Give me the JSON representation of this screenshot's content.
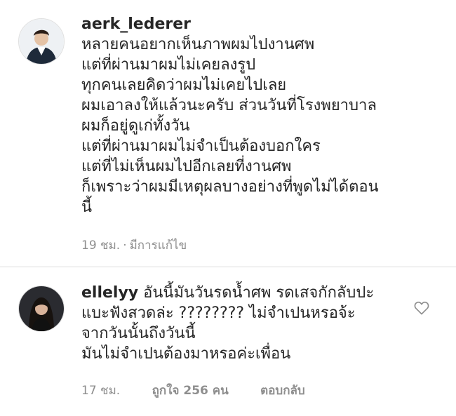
{
  "comments": [
    {
      "username": "aerk_lederer",
      "lines": [
        "หลายคนอยากเห็นภาพผมไปงานศพ",
        "แต่ที่ผ่านมาผมไม่เคยลงรูป",
        "ทุกคนเลยคิดว่าผมไม่เคยไปเลย",
        "ผมเอาลงให้แล้วนะครับ ส่วนวันที่โรงพยาบาล",
        "ผมก็อยู่ดูเก่ทั้งวัน",
        "แต่ที่ผ่านมาผมไม่จำเป็นต้องบอกใคร",
        "แต่ที่ไม่เห็นผมไปอีกเลยที่งานศพ",
        "ก็เพราะว่าผมมีเหตุผลบางอย่างที่พูดไม่ได้ตอน",
        "นี้"
      ],
      "time": "19 ชม.",
      "separator": "·",
      "edited": "มีการแก้ไข"
    },
    {
      "username": "ellelyy",
      "lines": [
        "อันนี้มันวันรดน้ำศพ รดเสจกักลับปะ",
        "แบะฟังสวดล่ะ ???????? ไม่จำเปนหรอจ้ะ",
        "จากวันนั้นถึงวันนี้",
        "มันไม่จำเปนต้องมาหรอค่ะเพื่อน"
      ],
      "time": "17 ชม.",
      "likes": "ถูกใจ 256 คน",
      "reply": "ตอบกลับ"
    }
  ],
  "icons": {
    "like": "heart-outline-icon"
  },
  "colors": {
    "text": "#262626",
    "meta": "#8e8e8e",
    "divider": "#dbdbdb"
  }
}
